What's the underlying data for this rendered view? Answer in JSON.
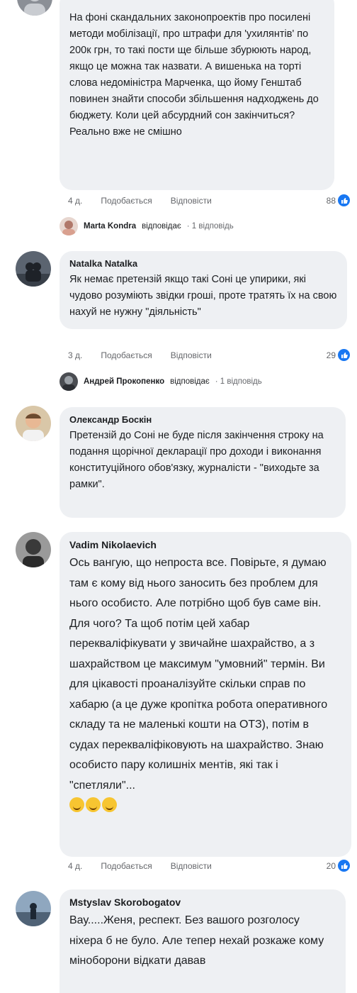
{
  "comment1": {
    "text": "На фоні скандальних законопроектів про посилені методи мобілізації, про штрафи для 'ухилянтів' по 200к грн, то такі пости ще більше збурюють народ, якщо це можна так назвати. А вишенька на торті слова недоміністра Марченка, що йому Генштаб повинен знайти способи збільшення надходжень до бюджету. Коли цей абсурдний сон закінчиться? Реально вже не смішно",
    "time": "4 д.",
    "like_label": "Подобається",
    "reply_label": "Відповісти",
    "reactions": "88",
    "reply": {
      "name": "Marta Kondra",
      "action": "відповідає",
      "count": "· 1 відповідь"
    }
  },
  "comment2": {
    "name": "Natalka Natalka",
    "text": "Як немає претензій якщо такі Соні це упирики, які чудово розуміють звідки гроші, проте тратять їх на свою нахуй не нужну \"діяльність\"",
    "time": "3 д.",
    "like_label": "Подобається",
    "reply_label": "Відповісти",
    "reactions": "29",
    "reply": {
      "name": "Андрей Прокопенко",
      "action": "відповідає",
      "count": "· 1 відповідь"
    }
  },
  "comment3": {
    "name": "Олександр Боскін",
    "text": "Претензій до Соні не буде після закінчення строку на подання щорічної декларації про доходи і виконання конституційного обов'язку, журналісти - \"виходьте за рамки\"."
  },
  "comment4": {
    "name": "Vadim Nikolaevich",
    "text": "Ось вангую, що непроста все. Повірьте, я думаю там є кому від нього заносить без проблем для нього особисто. Але потрібно щоб був саме він. Для чого? Та щоб потім цей хабар перекваліфікувати у звичайне шахрайство, а з шахрайством це максимум \"умовний\" термін. Ви для цікавості проаналізуйте скільки справ по хабарю (а це дуже кропітка робота оперативного складу та не маленькі кошти на ОТЗ), потім в судах перекваліфіковують на шахрайство. Знаю особисто пару колишніх ментів, які так і \"спетляли\"...",
    "time": "4 д.",
    "like_label": "Подобається",
    "reply_label": "Відповісти",
    "reactions": "20"
  },
  "comment5": {
    "name": "Mstyslav  Skorobogatov",
    "text": "Вау.....Женя, респект. Без вашого розголосу ніхера б не було. Але тепер нехай розкаже кому міноборони відкати давав"
  },
  "colors": {
    "bubble": "#eef0f3",
    "like_blue": "#1877f2",
    "meta": "#65676b"
  }
}
